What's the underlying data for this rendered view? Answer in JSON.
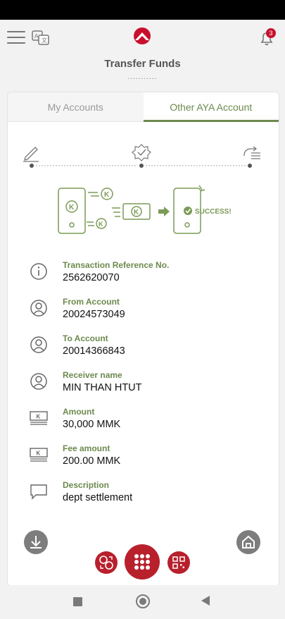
{
  "header": {
    "title": "Transfer Funds",
    "title_dots": "...........",
    "notification_count": "3"
  },
  "tabs": [
    {
      "label": "My Accounts",
      "active": false
    },
    {
      "label": "Other AYA Account",
      "active": true
    }
  ],
  "hero": {
    "success_text": "SUCCESS!"
  },
  "details": [
    {
      "label": "Transaction Reference No.",
      "value": "2562620070",
      "icon": "info-icon"
    },
    {
      "label": "From Account",
      "value": "20024573049",
      "icon": "user-icon"
    },
    {
      "label": "To Account",
      "value": "20014366843",
      "icon": "user-icon"
    },
    {
      "label": "Receiver name",
      "value": "MIN THAN HTUT",
      "icon": "user-icon"
    },
    {
      "label": "Amount",
      "value": "30,000 MMK",
      "icon": "money-icon"
    },
    {
      "label": "Fee amount",
      "value": "200.00 MMK",
      "icon": "money-icon"
    },
    {
      "label": "Description",
      "value": "dept settlement",
      "icon": "message-icon"
    }
  ],
  "colors": {
    "accent_green": "#6c8a4e",
    "brand_red": "#b8202c",
    "badge_red": "#c8102e"
  }
}
